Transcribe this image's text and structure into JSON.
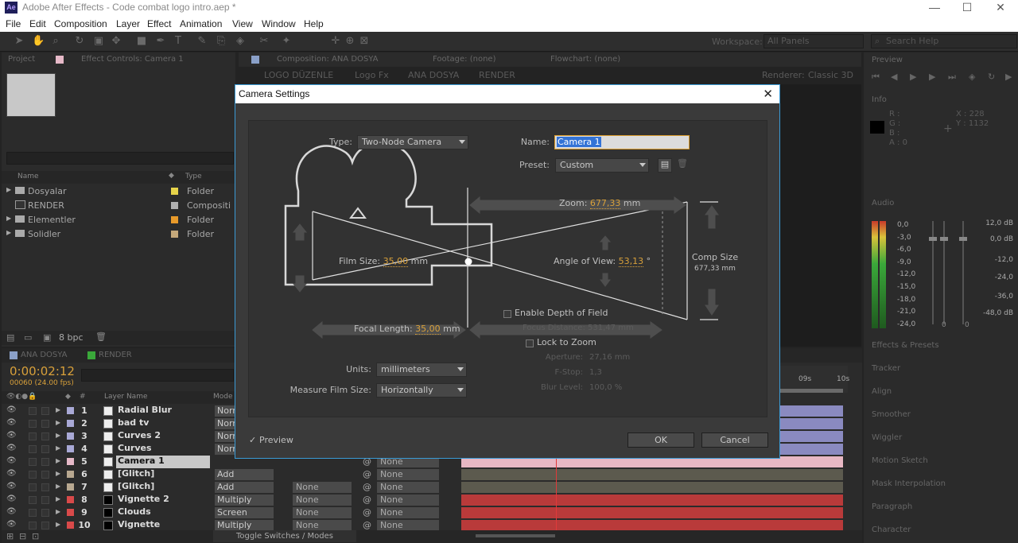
{
  "window": {
    "title": "Adobe After Effects - Code combat logo intro.aep *",
    "icon": "Ae"
  },
  "menu": [
    "File",
    "Edit",
    "Composition",
    "Layer",
    "Effect",
    "Animation",
    "View",
    "Window",
    "Help"
  ],
  "toolbar": {
    "workspace_label": "Workspace:",
    "workspace_value": "All Panels",
    "search_placeholder": "Search Help"
  },
  "project_panel": {
    "tabs": [
      "Project",
      "Effect Controls: Camera 1"
    ],
    "col_name": "Name",
    "col_type": "Type",
    "items": [
      {
        "name": "Dosyalar",
        "type": "Folder",
        "color": "#e6d34a"
      },
      {
        "name": "RENDER",
        "type": "Compositi",
        "color": "#b0b0b0"
      },
      {
        "name": "Elementler",
        "type": "Folder",
        "color": "#e89a2a"
      },
      {
        "name": "Solidler",
        "type": "Folder",
        "color": "#c4a87a"
      }
    ],
    "bpc": "8 bpc"
  },
  "comp_panel": {
    "tabs": [
      "Composition: ANA DOSYA",
      "Footage: (none)",
      "Flowchart: (none)"
    ],
    "breadcrumb": [
      "LOGO DÜZENLE",
      "Logo Fx",
      "ANA DOSYA",
      "RENDER"
    ],
    "renderer_label": "Renderer:",
    "renderer_value": "Classic 3D"
  },
  "right_panels": {
    "preview": "Preview",
    "info": "Info",
    "info_rgba": [
      "R :",
      "G :",
      "B :",
      "A : 0"
    ],
    "info_xy": [
      "X : 228",
      "Y : 1132"
    ],
    "audio": "Audio",
    "audio_left": [
      "0,0",
      "-3,0",
      "-6,0",
      "-9,0",
      "-12,0",
      "-15,0",
      "-18,0",
      "-21,0",
      "-24,0"
    ],
    "audio_right": [
      "12,0 dB",
      "0,0 dB",
      "-12,0",
      "-24,0",
      "-36,0",
      "-48,0 dB"
    ],
    "audio_zero": [
      "0",
      "0"
    ],
    "stack": [
      "Effects & Presets",
      "Tracker",
      "Align",
      "Smoother",
      "Wiggler",
      "Motion Sketch",
      "Mask Interpolation",
      "Paragraph",
      "Character"
    ]
  },
  "timeline": {
    "tabs": [
      "ANA DOSYA",
      "RENDER"
    ],
    "timecode": "0:00:02:12",
    "frames": "00060 (24.00 fps)",
    "col_num": "#",
    "col_layer": "Layer Name",
    "col_mode": "Mode",
    "ruler": [
      "09s",
      "10s"
    ],
    "footer": "Toggle Switches / Modes",
    "layers": [
      {
        "n": "1",
        "name": "Radial Blur",
        "mode": "Norm",
        "trk": "",
        "parent": "",
        "color": "#a9a9d6"
      },
      {
        "n": "2",
        "name": "bad tv",
        "mode": "Norm",
        "trk": "",
        "parent": "",
        "color": "#a9a9d6"
      },
      {
        "n": "3",
        "name": "Curves 2",
        "mode": "Norm",
        "trk": "",
        "parent": "",
        "color": "#a9a9d6"
      },
      {
        "n": "4",
        "name": "Curves",
        "mode": "Norm",
        "trk": "",
        "parent": "",
        "color": "#a9a9d6"
      },
      {
        "n": "5",
        "name": "Camera 1",
        "mode": "",
        "trk": "",
        "parent": "None",
        "color": "#e6b9c8"
      },
      {
        "n": "6",
        "name": "[Glitch]",
        "mode": "Add",
        "trk": "",
        "parent": "None",
        "color": "#b8a890"
      },
      {
        "n": "7",
        "name": "[Glitch]",
        "mode": "Add",
        "trk": "None",
        "parent": "None",
        "color": "#b8a890"
      },
      {
        "n": "8",
        "name": "Vignette 2",
        "mode": "Multiply",
        "trk": "None",
        "parent": "None",
        "color": "#d94a4a"
      },
      {
        "n": "9",
        "name": "Clouds",
        "mode": "Screen",
        "trk": "None",
        "parent": "None",
        "color": "#d94a4a"
      },
      {
        "n": "10",
        "name": "Vignette",
        "mode": "Multiply",
        "trk": "None",
        "parent": "None",
        "color": "#d94a4a"
      }
    ]
  },
  "dialog": {
    "title": "Camera Settings",
    "type_label": "Type:",
    "type_value": "Two-Node Camera",
    "name_label": "Name:",
    "name_value": "Camera 1",
    "preset_label": "Preset:",
    "preset_value": "Custom",
    "zoom_label": "Zoom:",
    "zoom_value": "677,33",
    "zoom_unit": "mm",
    "film_size_label": "Film Size:",
    "film_size_value": "35,00",
    "film_size_unit": "mm",
    "aov_label": "Angle of View:",
    "aov_value": "53,13",
    "aov_unit": "°",
    "comp_size_label": "Comp Size",
    "comp_size_value": "677,33 mm",
    "focal_label": "Focal Length:",
    "focal_value": "35,00",
    "focal_unit": "mm",
    "dof_label": "Enable Depth of Field",
    "focus_dist": "Focus Distance:",
    "focus_dist_value": "531,47 mm",
    "lock_zoom": "Lock to Zoom",
    "aperture": "Aperture:",
    "aperture_value": "27,16 mm",
    "fstop": "F-Stop:",
    "fstop_value": "1,3",
    "blur": "Blur Level:",
    "blur_value": "100,0 %",
    "units_label": "Units:",
    "units_value": "millimeters",
    "measure_label": "Measure Film Size:",
    "measure_value": "Horizontally",
    "preview_label": "Preview",
    "ok": "OK",
    "cancel": "Cancel"
  }
}
